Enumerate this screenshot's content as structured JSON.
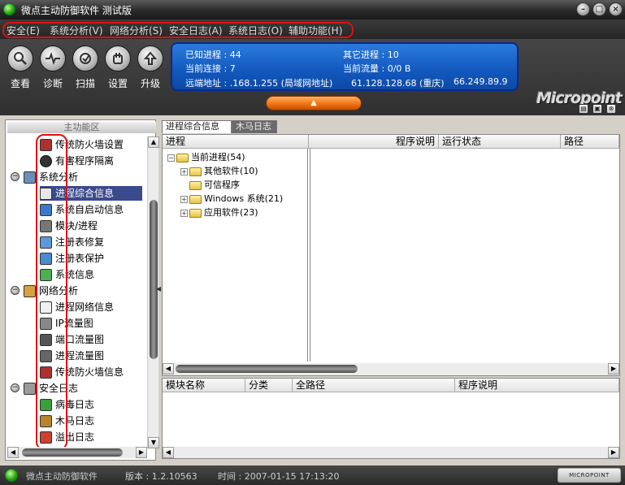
{
  "window": {
    "title": "微点主动防御软件  测试版",
    "controls": [
      "minimize",
      "restore",
      "close"
    ]
  },
  "menu": {
    "items": [
      {
        "label": "安全(E)"
      },
      {
        "label": "系统分析(V)"
      },
      {
        "label": "网络分析(S)"
      },
      {
        "label": "安全日志(A)"
      },
      {
        "label": "系统日志(O)"
      },
      {
        "label": "辅助功能(H)"
      }
    ]
  },
  "toolbar": {
    "buttons": [
      {
        "label": "查看",
        "icon": "magnifier-icon"
      },
      {
        "label": "诊断",
        "icon": "heartbeat-icon"
      },
      {
        "label": "扫描",
        "icon": "scan-icon"
      },
      {
        "label": "设置",
        "icon": "hand-icon"
      },
      {
        "label": "升级",
        "icon": "upgrade-icon"
      }
    ]
  },
  "info": {
    "known_processes": "已知进程 : 44",
    "other_processes": "其它进程 : 10",
    "current_connections": "当前连接 : 7",
    "current_traffic": "当前流量 : 0/0 B",
    "remote_address_label": "远端地址 : .168.1.255 (局域网地址)",
    "remote_address_2": "61.128.128.68 (重庆)",
    "remote_address_3": "66.249.89.9"
  },
  "logo": {
    "text": "Micropoint"
  },
  "left_panel": {
    "header": "主功能区",
    "items": [
      {
        "label": "传统防火墙设置",
        "level": 1,
        "icon": "firewall-icon"
      },
      {
        "label": "有害程序隔离",
        "level": 1,
        "icon": "quarantine-icon"
      },
      {
        "label": "系统分析",
        "level": 0,
        "icon": "system-analysis-icon"
      },
      {
        "label": "进程综合信息",
        "level": 1,
        "icon": "process-info-icon",
        "selected": true
      },
      {
        "label": "系统自启动信息",
        "level": 1,
        "icon": "autostart-icon"
      },
      {
        "label": "模块/进程",
        "level": 1,
        "icon": "module-icon"
      },
      {
        "label": "注册表修复",
        "level": 1,
        "icon": "registry-repair-icon"
      },
      {
        "label": "注册表保护",
        "level": 1,
        "icon": "registry-protect-icon"
      },
      {
        "label": "系统信息",
        "level": 1,
        "icon": "system-info-icon"
      },
      {
        "label": "网络分析",
        "level": 0,
        "icon": "network-analysis-icon"
      },
      {
        "label": "进程网络信息",
        "level": 1,
        "icon": "process-network-icon"
      },
      {
        "label": "IP流量图",
        "level": 1,
        "icon": "ip-traffic-icon"
      },
      {
        "label": "端口流量图",
        "level": 1,
        "icon": "port-traffic-icon"
      },
      {
        "label": "进程流量图",
        "level": 1,
        "icon": "process-traffic-icon"
      },
      {
        "label": "传统防火墙信息",
        "level": 1,
        "icon": "firewall-info-icon"
      },
      {
        "label": "安全日志",
        "level": 0,
        "icon": "security-log-icon"
      },
      {
        "label": "病毒日志",
        "level": 1,
        "icon": "virus-log-icon"
      },
      {
        "label": "木马日志",
        "level": 1,
        "icon": "trojan-log-icon"
      },
      {
        "label": "溢出日志",
        "level": 1,
        "icon": "overflow-log-icon"
      }
    ]
  },
  "tabs": [
    {
      "label": "进程综合信息",
      "active": true
    },
    {
      "label": "木马日志",
      "active": false
    }
  ],
  "process_grid": {
    "columns": [
      "进程",
      "程序说明",
      "运行状态",
      "路径"
    ],
    "root": "当前进程(54)",
    "children": [
      {
        "label": "其他软件(10)",
        "expandable": true
      },
      {
        "label": "可信程序",
        "expandable": false
      },
      {
        "label": "Windows 系统(21)",
        "expandable": true
      },
      {
        "label": "应用软件(23)",
        "expandable": true
      }
    ]
  },
  "module_grid": {
    "columns": [
      "模块名称",
      "分类",
      "全路径",
      "程序说明"
    ]
  },
  "status": {
    "app_name": "微点主动防御软件",
    "version": "版本 : 1.2.10563",
    "time": "时间 : 2007-01-15  17:13:20",
    "badge": "MICROPOINT"
  }
}
